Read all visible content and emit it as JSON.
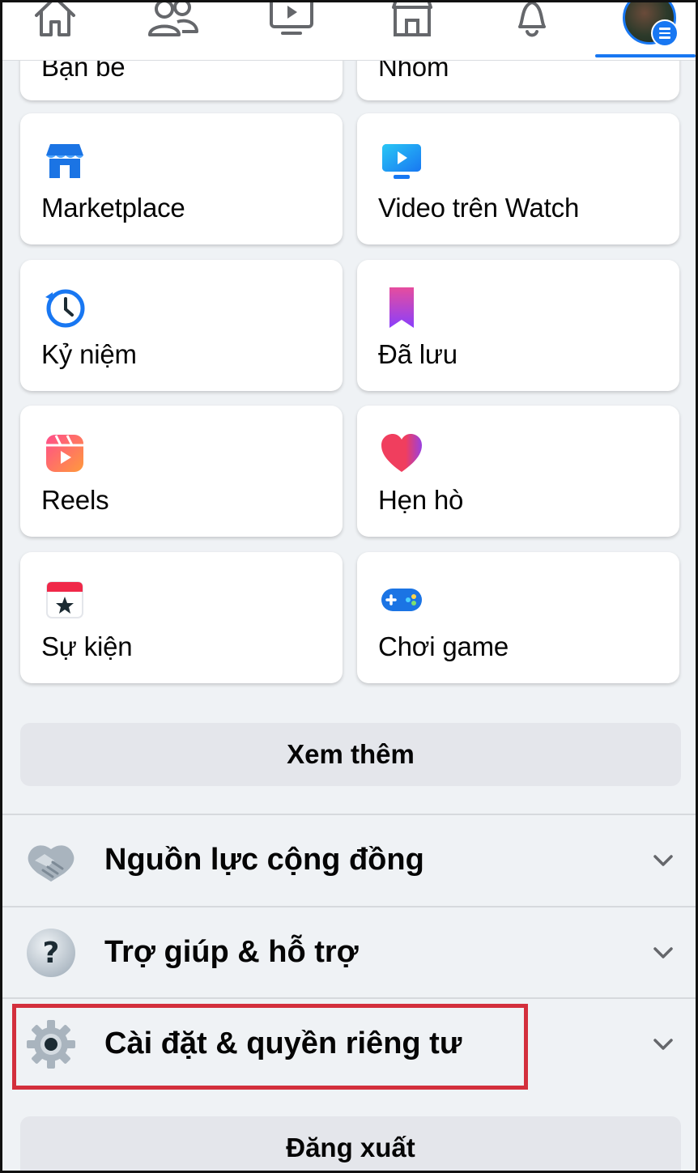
{
  "nav": {
    "icons": [
      "home-icon",
      "friends-icon",
      "watch-icon",
      "marketplace-icon",
      "notifications-icon",
      "menu-icon"
    ],
    "active_color": "#1877f2"
  },
  "shortcuts": {
    "partial_left": "Bạn bè",
    "partial_right": "Nhóm",
    "items": [
      {
        "label": "Marketplace",
        "icon": "marketplace-icon"
      },
      {
        "label": "Video trên Watch",
        "icon": "watch-video-icon"
      },
      {
        "label": "Kỷ niệm",
        "icon": "memories-icon"
      },
      {
        "label": "Đã lưu",
        "icon": "saved-icon"
      },
      {
        "label": "Reels",
        "icon": "reels-icon"
      },
      {
        "label": "Hẹn hò",
        "icon": "dating-icon"
      },
      {
        "label": "Sự kiện",
        "icon": "events-icon"
      },
      {
        "label": "Chơi game",
        "icon": "gaming-icon"
      }
    ]
  },
  "see_more_label": "Xem thêm",
  "sections": [
    {
      "label": "Nguồn lực cộng đồng",
      "icon": "handshake-icon"
    },
    {
      "label": "Trợ giúp & hỗ trợ",
      "icon": "help-icon"
    },
    {
      "label": "Cài đặt & quyền riêng tư",
      "icon": "settings-gear-icon"
    }
  ],
  "logout_label": "Đăng xuất",
  "colors": {
    "brand": "#1877f2",
    "highlight": "#d32f3c",
    "background": "#eff2f5"
  }
}
